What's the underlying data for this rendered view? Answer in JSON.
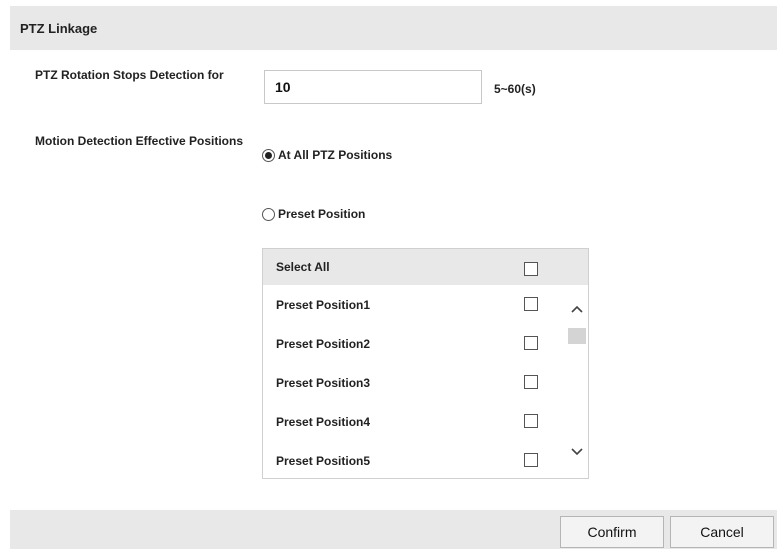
{
  "header": {
    "title": "PTZ Linkage"
  },
  "rotation": {
    "label": "PTZ Rotation Stops Detection for",
    "value": "10",
    "range_hint": "5~60(s)"
  },
  "effective": {
    "label": "Motion Detection Effective Positions",
    "options": [
      {
        "label": "At All PTZ Positions",
        "selected": true
      },
      {
        "label": "Preset Position",
        "selected": false
      }
    ]
  },
  "presets": {
    "select_all_label": "Select All",
    "select_all_checked": false,
    "items": [
      {
        "label": "Preset Position1",
        "checked": false
      },
      {
        "label": "Preset Position2",
        "checked": false
      },
      {
        "label": "Preset Position3",
        "checked": false
      },
      {
        "label": "Preset Position4",
        "checked": false
      },
      {
        "label": "Preset Position5",
        "checked": false
      }
    ],
    "scroll_up_icon": "chevron-up-icon",
    "scroll_down_icon": "chevron-down-icon"
  },
  "footer": {
    "confirm_label": "Confirm",
    "cancel_label": "Cancel"
  }
}
